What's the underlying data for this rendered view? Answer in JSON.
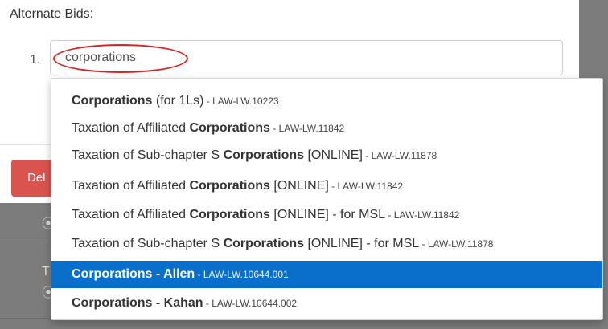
{
  "form": {
    "heading": "Alternate Bids:",
    "item_number": "1.",
    "search_value": "corporations",
    "delete_label_partial": "Del"
  },
  "background_partial_text": "T",
  "colors": {
    "highlight": "#0a6ecb",
    "delete_button": "#d9534f",
    "annotation_circle": "#e02020"
  },
  "dropdown": {
    "items": [
      {
        "pre": "",
        "bold": "Corporations",
        "post": " (for 1Ls)",
        "code": " - LAW-LW.10223"
      },
      {
        "pre": "Taxation of Affiliated ",
        "bold": "Corporations",
        "post": "",
        "code": " - LAW-LW.11842"
      },
      {
        "pre": "Taxation of Sub-chapter S ",
        "bold": "Corporations",
        "post": " [ONLINE]",
        "code": " - LAW-LW.11878"
      },
      {
        "pre": "Taxation of Affiliated ",
        "bold": "Corporations",
        "post": " [ONLINE]",
        "code": " - LAW-LW.11842"
      },
      {
        "pre": "Taxation of Affiliated ",
        "bold": "Corporations",
        "post": " [ONLINE] - for MSL",
        "code": " - LAW-LW.11842"
      },
      {
        "pre": "Taxation of Sub-chapter S ",
        "bold": "Corporations",
        "post": " [ONLINE] - for MSL",
        "code": " - LAW-LW.11878"
      },
      {
        "pre": "",
        "bold": "Corporations - Allen",
        "post": "",
        "code": " - LAW-LW.10644.001"
      },
      {
        "pre": "",
        "bold": "Corporations - Kahan",
        "post": "",
        "code": " - LAW-LW.10644.002"
      }
    ]
  }
}
